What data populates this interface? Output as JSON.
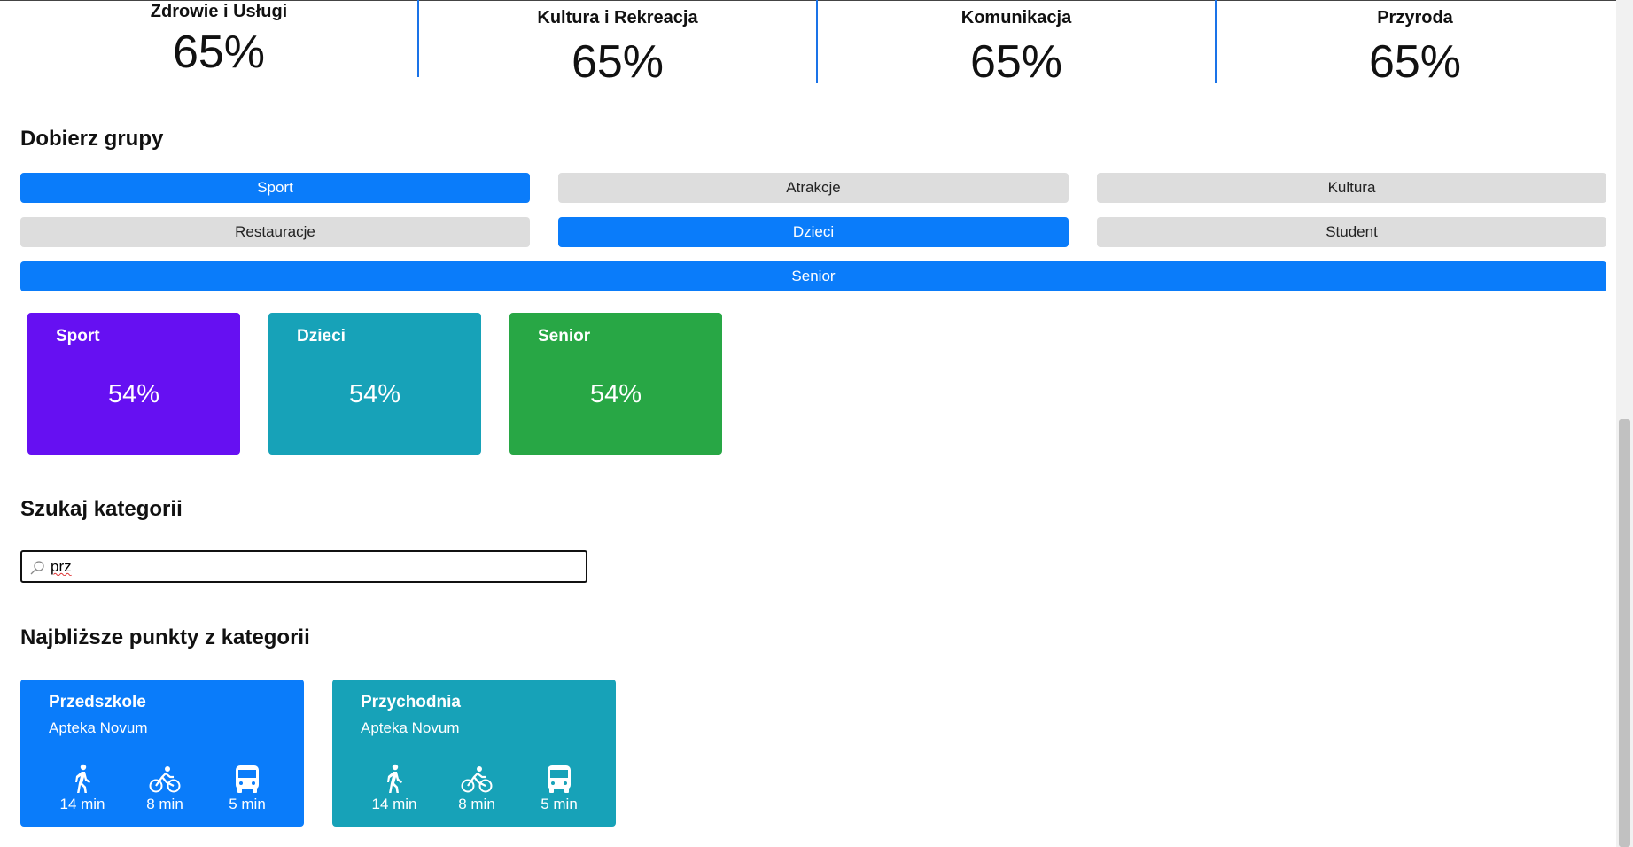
{
  "stats": [
    {
      "label": "Zdrowie i Usługi",
      "value": "65%"
    },
    {
      "label": "Kultura i Rekreacja",
      "value": "65%"
    },
    {
      "label": "Komunikacja",
      "value": "65%"
    },
    {
      "label": "Przyroda",
      "value": "65%"
    }
  ],
  "groups": {
    "title": "Dobierz grupy",
    "buttons": [
      {
        "label": "Sport",
        "active": true
      },
      {
        "label": "Atrakcje",
        "active": false
      },
      {
        "label": "Kultura",
        "active": false
      },
      {
        "label": "Restauracje",
        "active": false
      },
      {
        "label": "Dzieci",
        "active": true
      },
      {
        "label": "Student",
        "active": false
      },
      {
        "label": "Senior",
        "active": true
      }
    ],
    "cards": [
      {
        "label": "Sport",
        "value": "54%",
        "color": "#6610f2"
      },
      {
        "label": "Dzieci",
        "value": "54%",
        "color": "#17a2b8"
      },
      {
        "label": "Senior",
        "value": "54%",
        "color": "#28a745"
      }
    ]
  },
  "search": {
    "title": "Szukaj kategorii",
    "value": "prz",
    "icon": "magnifier-icon"
  },
  "nearest": {
    "title": "Najbliższe punkty z kategorii",
    "cards": [
      {
        "title": "Przedszkole",
        "subtitle": "Apteka Novum",
        "color": "#0a7cfa",
        "walk": "14 min",
        "bike": "8 min",
        "bus": "5 min"
      },
      {
        "title": "Przychodnia",
        "subtitle": "Apteka Novum",
        "color": "#17a2b8",
        "walk": "14 min",
        "bike": "8 min",
        "bus": "5 min"
      }
    ]
  },
  "colors": {
    "accent": "#0a7cfa",
    "inactive": "#dddddd",
    "divider": "#1a73e8"
  }
}
